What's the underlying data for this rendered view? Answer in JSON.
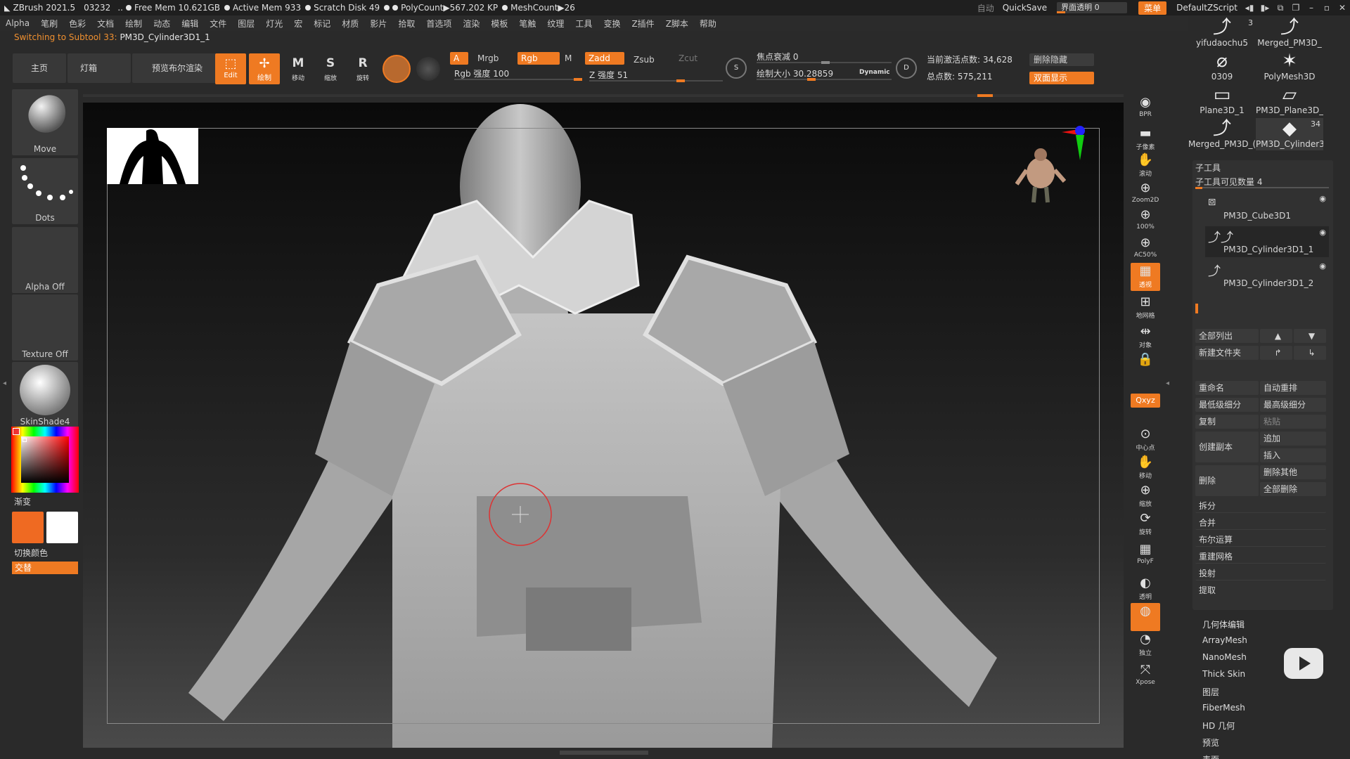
{
  "titlebar": {
    "app": "ZBrush 2021.5",
    "num": "03232",
    "free_mem": "Free Mem 10.621GB",
    "active_mem": "Active Mem 933",
    "scratch": "Scratch Disk 49",
    "polycount": "PolyCount▶567.202 KP",
    "meshcount": "MeshCount▶26",
    "auto": "自动",
    "quicksave": "QuickSave",
    "ui_transparency": "界面透明 0",
    "menu": "菜单",
    "script": "DefaultZScript"
  },
  "menus": [
    "Alpha",
    "笔刷",
    "色彩",
    "文档",
    "绘制",
    "动态",
    "编辑",
    "文件",
    "图层",
    "灯光",
    "宏",
    "标记",
    "材质",
    "影片",
    "拾取",
    "首选项",
    "渲染",
    "模板",
    "笔触",
    "纹理",
    "工具",
    "变换",
    "Z插件",
    "Z脚本",
    "帮助"
  ],
  "status": {
    "prefix": "Switching to Subtool 33:",
    "name": "PM3D_Cylinder3D1_1"
  },
  "toolbar": {
    "home": "主页",
    "lightbox": "灯箱",
    "bpr": "预览布尔渲染",
    "edit": "Edit",
    "draw": "绘制",
    "move": "移动",
    "scale": "缩放",
    "rotate": "旋转",
    "a": "A",
    "mrgb": "Mrgb",
    "rgb": "Rgb",
    "m": "M",
    "zadd": "Zadd",
    "zsub": "Zsub",
    "zcut": "Zcut",
    "rgb_intensity": "Rgb 强度 100",
    "z_intensity": "Z 强度 51",
    "focal": "焦点衰减 0",
    "draw_size": "绘制大小 30.28859",
    "dynamic": "Dynamic",
    "active_points": "当前激活点数: 34,628",
    "total_points": "总点数: 575,211",
    "del_hidden": "删除隐藏",
    "double": "双面显示"
  },
  "lefttray": {
    "move": "Move",
    "dots": "Dots",
    "alpha": "Alpha Off",
    "texture": "Texture Off",
    "material": "SkinShade4",
    "gradient": "渐变",
    "switch": "切换颜色",
    "alternate": "交替"
  },
  "rightstrip": [
    {
      "name": "bpr",
      "label": "BPR"
    },
    {
      "name": "subpixel",
      "label": "子像素"
    },
    {
      "name": "scroll",
      "label": "滚动"
    },
    {
      "name": "zoom2d",
      "label": "Zoom2D"
    },
    {
      "name": "100",
      "label": "100%"
    },
    {
      "name": "ac50",
      "label": "AC50%"
    },
    {
      "name": "persp",
      "label": "透视"
    },
    {
      "name": "floor",
      "label": "地网格"
    },
    {
      "name": "local",
      "label": "对象"
    },
    {
      "name": "lock",
      "label": ""
    },
    {
      "name": "xyz",
      "label": "Qxyz"
    },
    {
      "name": "center",
      "label": "中心点"
    },
    {
      "name": "move",
      "label": "移动"
    },
    {
      "name": "zoom",
      "label": "缩放"
    },
    {
      "name": "rotate",
      "label": "旋转"
    },
    {
      "name": "polyf",
      "label": "PolyF"
    },
    {
      "name": "transp",
      "label": "透明"
    },
    {
      "name": "ghost",
      "label": ""
    },
    {
      "name": "solo",
      "label": "独立"
    },
    {
      "name": "xpose",
      "label": "Xpose"
    }
  ],
  "rightpanel": {
    "thumbs": [
      {
        "label": "yifudaochu5",
        "count": "3"
      },
      {
        "label": "Merged_PM3D_",
        "count": ""
      },
      {
        "label": "0309",
        "count": ""
      },
      {
        "label": "PolyMesh3D",
        "count": ""
      },
      {
        "label": "Plane3D_1",
        "count": ""
      },
      {
        "label": "PM3D_Plane3D_",
        "count": ""
      },
      {
        "label": "Merged_PM3D_(",
        "count": ""
      },
      {
        "label": "PM3D_Cylinder3",
        "count": "34"
      }
    ],
    "subtool_title": "子工具",
    "visible_count": "子工具可见数量 4",
    "subtools": [
      "PM3D_Cube3D1",
      "PM3D_Cylinder3D1_1",
      "PM3D_Cylinder3D1_2"
    ],
    "list_all": "全部列出",
    "new_folder": "新建文件夹",
    "rename": "重命名",
    "autoreorder": "自动重排",
    "lowest": "最低级细分",
    "highest": "最高级细分",
    "copy": "复制",
    "paste": "粘贴",
    "duplicate": "创建副本",
    "append": "追加",
    "insert": "插入",
    "delete": "删除",
    "del_other": "删除其他",
    "del_all": "全部删除",
    "split": "拆分",
    "merge": "合并",
    "boolean": "布尔运算",
    "remesh": "重建网格",
    "project": "投射",
    "extract": "提取",
    "menu_list": [
      "几何体编辑",
      "ArrayMesh",
      "NanoMesh",
      "Thick Skin",
      "图层",
      "FiberMesh",
      "HD 几何",
      "预览",
      "表面"
    ]
  },
  "colors": {
    "accent": "#ef7a22",
    "bg": "#2a2a2a"
  }
}
